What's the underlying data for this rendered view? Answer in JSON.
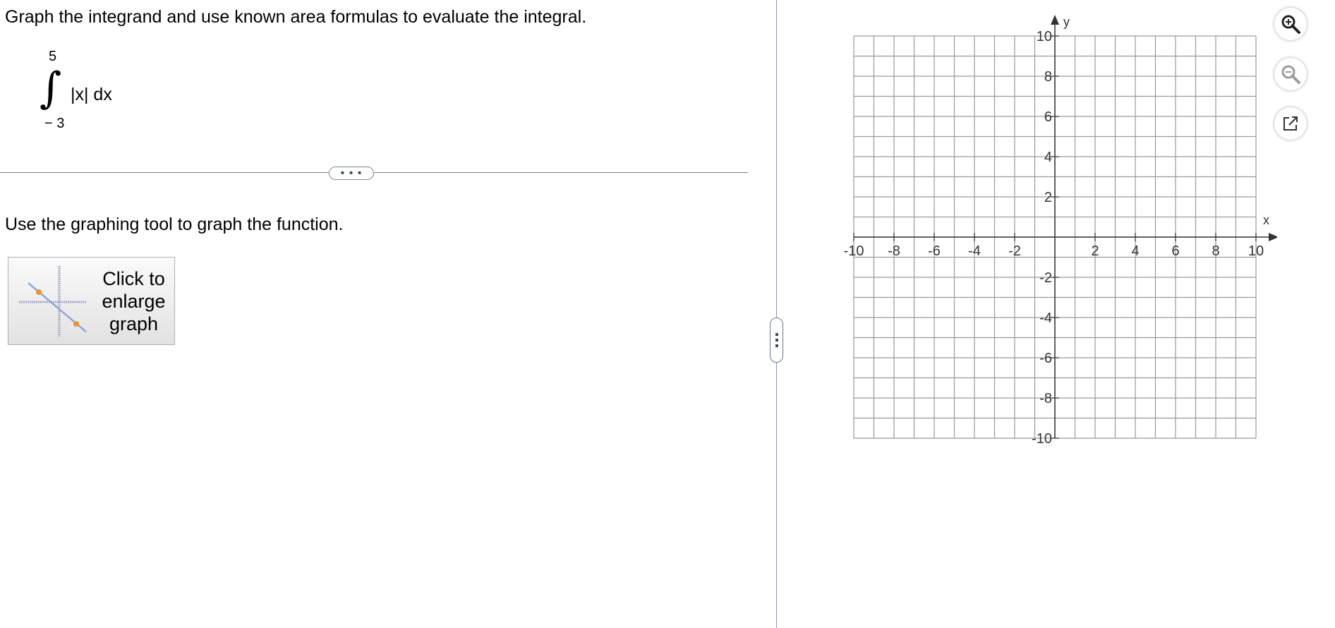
{
  "question": {
    "text": "Graph the integrand and use known area formulas to evaluate the integral.",
    "integral": {
      "upper": "5",
      "lower": "− 3",
      "integrand": "|x| dx"
    }
  },
  "expand_button": "• • •",
  "instruction": "Use the graphing tool to graph the function.",
  "enlarge_button": {
    "lines": [
      "Click to",
      "enlarge",
      "graph"
    ]
  },
  "graph": {
    "x_label": "x",
    "y_label": "y",
    "x_ticks": [
      "-10",
      "-8",
      "-6",
      "-4",
      "-2",
      "2",
      "4",
      "6",
      "8",
      "10"
    ],
    "y_ticks": [
      "10",
      "8",
      "6",
      "4",
      "2",
      "-2",
      "-4",
      "-6",
      "-8",
      "-10"
    ],
    "x_range": [
      -10,
      10
    ],
    "y_range": [
      -10,
      10
    ],
    "grid_step": 1,
    "label_step": 2,
    "colors": {
      "grid": "#9a9a9a",
      "axis": "#333333",
      "thumb_line": "#8fa6dc",
      "thumb_point": "#f0932b"
    }
  },
  "tools": {
    "zoom_in": {
      "icon": "zoom-in-icon"
    },
    "zoom_out": {
      "icon": "zoom-out-icon"
    },
    "popout": {
      "icon": "external-link-icon"
    }
  }
}
